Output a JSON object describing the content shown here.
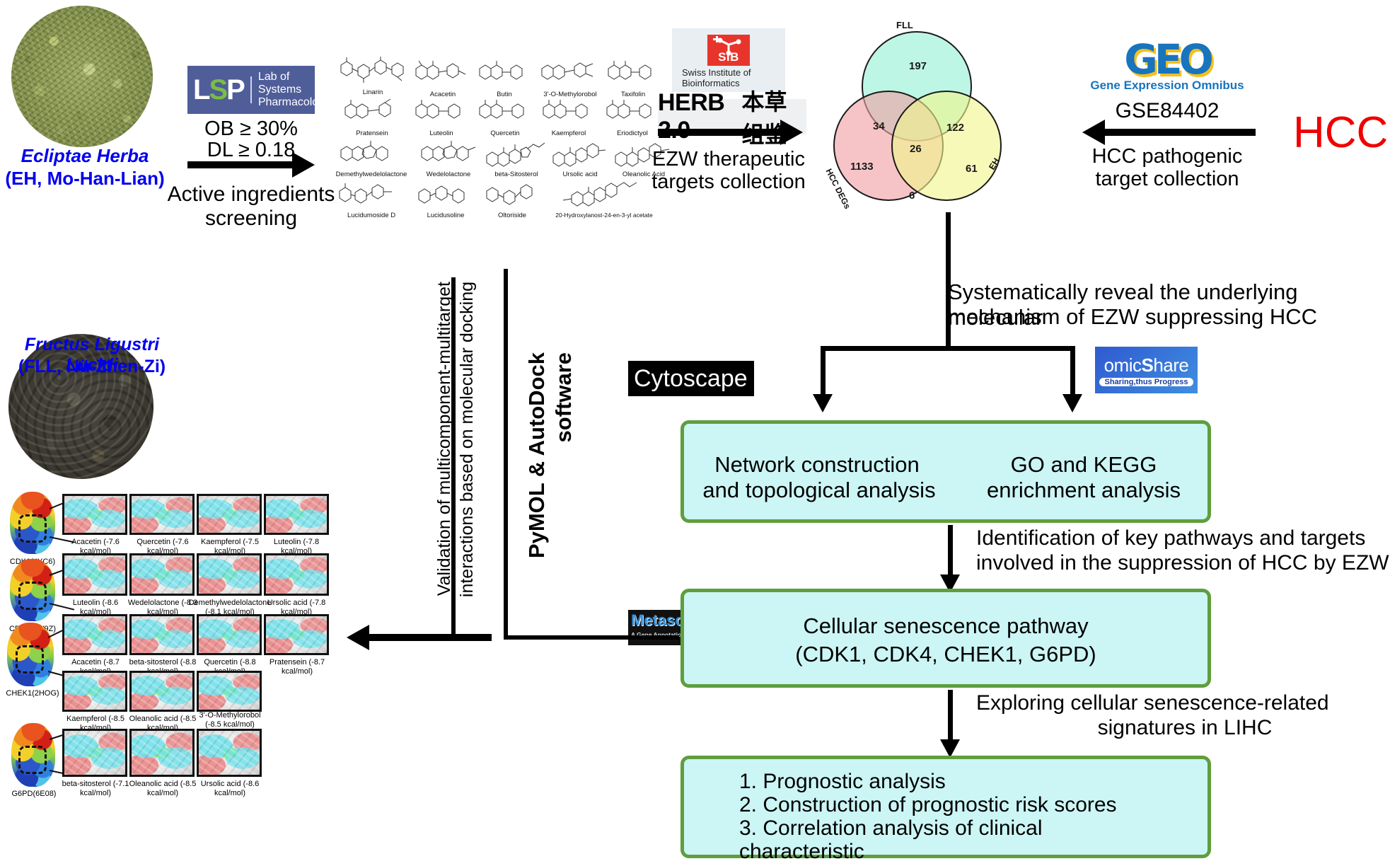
{
  "herbs": {
    "eh": {
      "name": "Ecliptae Herba",
      "alias": "(EH, Mo-Han-Lian)"
    },
    "fll": {
      "name": "Fructus Ligustri Lucidi",
      "alias": "(FLL, Nü-Zhen-Zi)"
    }
  },
  "lsp": {
    "mark_l": "L",
    "mark_s": "S",
    "mark_p": "P",
    "line1": "Lab of Systems",
    "line2": "Pharmacology",
    "criteria_ob": "OB ≥ 30%",
    "criteria_dl": "DL ≥ 0.18",
    "arrow_label_1": "Active ingredients",
    "arrow_label_2": "screening"
  },
  "compounds": [
    "Linarin",
    "Acacetin",
    "Butin",
    "3'-O-Methylorobol",
    "Taxifolin",
    "Pratensein",
    "Luteolin",
    "Quercetin",
    "Kaempferol",
    "Eriodictyol",
    "Demethylwedelolactone",
    "Wedelolactone",
    "beta-Sitosterol",
    "Ursolic acid",
    "Oleanolic Acid",
    "Lucidumoside D",
    "Lucidusoline",
    "Oltoriside",
    "20-Hydroxylanost-24-en-3-yl acetate"
  ],
  "sib": {
    "badge": "SIB",
    "cap1": "Swiss Institute of",
    "cap2": "Bioinformatics"
  },
  "herb_db": {
    "en": "HERB 2.0",
    "cn": "本草组鉴"
  },
  "ezw_arrow": {
    "line1": "EZW therapeutic",
    "line2": "targets collection"
  },
  "geo": {
    "logo": "GEO",
    "subtitle": "Gene Expression Omnibus",
    "dataset": "GSE84402"
  },
  "hcc_arrow": {
    "line1": "HCC pathogenic",
    "line2": "target collection"
  },
  "hcc_label": "HCC",
  "venn": {
    "labels": {
      "top": "FLL",
      "left": "HCC DEGs",
      "right": "EH"
    },
    "regions": {
      "fll_only": "197",
      "fll_hcc": "34",
      "fll_eh": "122",
      "center": "26",
      "hcc_only": "1133",
      "hcc_eh": "6",
      "eh_only": "61"
    },
    "colors": {
      "fll": "#bdf0e0",
      "hcc": "#f0b5b8",
      "eh": "#f2f5a8"
    }
  },
  "reveal_text": {
    "line1": "Systematically reveal the underlying molecular",
    "line2": "mechanism of EZW suppressing HCC"
  },
  "tools": {
    "metascape": "Metascape",
    "metascape_sub": "A Gene Annotation & Analysis Resource",
    "cytoscape": "Cytoscape",
    "omicshare_a": "omic",
    "omicshare_b": "S",
    "omicshare_c": "hare",
    "omicshare_tag": "Sharing,thus Progress"
  },
  "analysis_box": {
    "left_l1": "Network construction",
    "left_l2": "and topological analysis",
    "right_l1": "GO and KEGG",
    "right_l2": "enrichment analysis"
  },
  "identification_text": {
    "line1": "Identification of key pathways and targets",
    "line2": "involved in the suppression of HCC by EZW"
  },
  "pathway_box": {
    "line1": "Cellular senescence pathway",
    "line2": "(CDK1, CDK4, CHEK1, G6PD)"
  },
  "exploring_text": {
    "line1": "Exploring cellular senescence-related",
    "line2": "signatures in LIHC"
  },
  "outcome_box": {
    "item1": "1. Prognostic analysis",
    "item2": "2. Construction of prognostic risk scores",
    "item3": "3. Correlation analysis of clinical",
    "item3b": "    characteristic"
  },
  "validation_text": {
    "line1": "Validation of multicomponent-multitarget",
    "line2": "interactions based on molecular docking"
  },
  "software_text": {
    "line1": "PyMOL & AutoDock",
    "line2": "software"
  },
  "docking": [
    {
      "protein": "CDK1(4YC6)",
      "poses": [
        "Acacetin (-7.6 kcal/mol)",
        "Quercetin (-7.6 kcal/mol)",
        "Kaempferol (-7.5 kcal/mol)",
        "Luteolin (-7.8 kcal/mol)"
      ]
    },
    {
      "protein": "CDK4(2W9Z)",
      "poses": [
        "Luteolin (-8.6 kcal/mol)",
        "Wedelolactone (-8.3 kcal/mol)",
        "Demethylwedelolactone (-8.1 kcal/mol)",
        "Ursolic acid (-7.8 kcal/mol)"
      ]
    },
    {
      "protein": "CHEK1(2HOG)",
      "poses": [
        "Acacetin (-8.7 kcal/mol)",
        "beta-sitosterol (-8.8 kcal/mol)",
        "Quercetin (-8.8 kcal/mol)",
        "Pratensein (-8.7 kcal/mol)",
        "Kaempferol (-8.5 kcal/mol)",
        "Oleanolic acid (-8.5 kcal/mol)",
        "3'-O-Methylorobol (-8.5 kcal/mol)"
      ]
    },
    {
      "protein": "G6PD(6E08)",
      "poses": [
        "beta-sitosterol (-7.1 kcal/mol)",
        "Oleanolic acid (-8.5 kcal/mol)",
        "Ursolic acid (-8.6 kcal/mol)"
      ]
    }
  ]
}
